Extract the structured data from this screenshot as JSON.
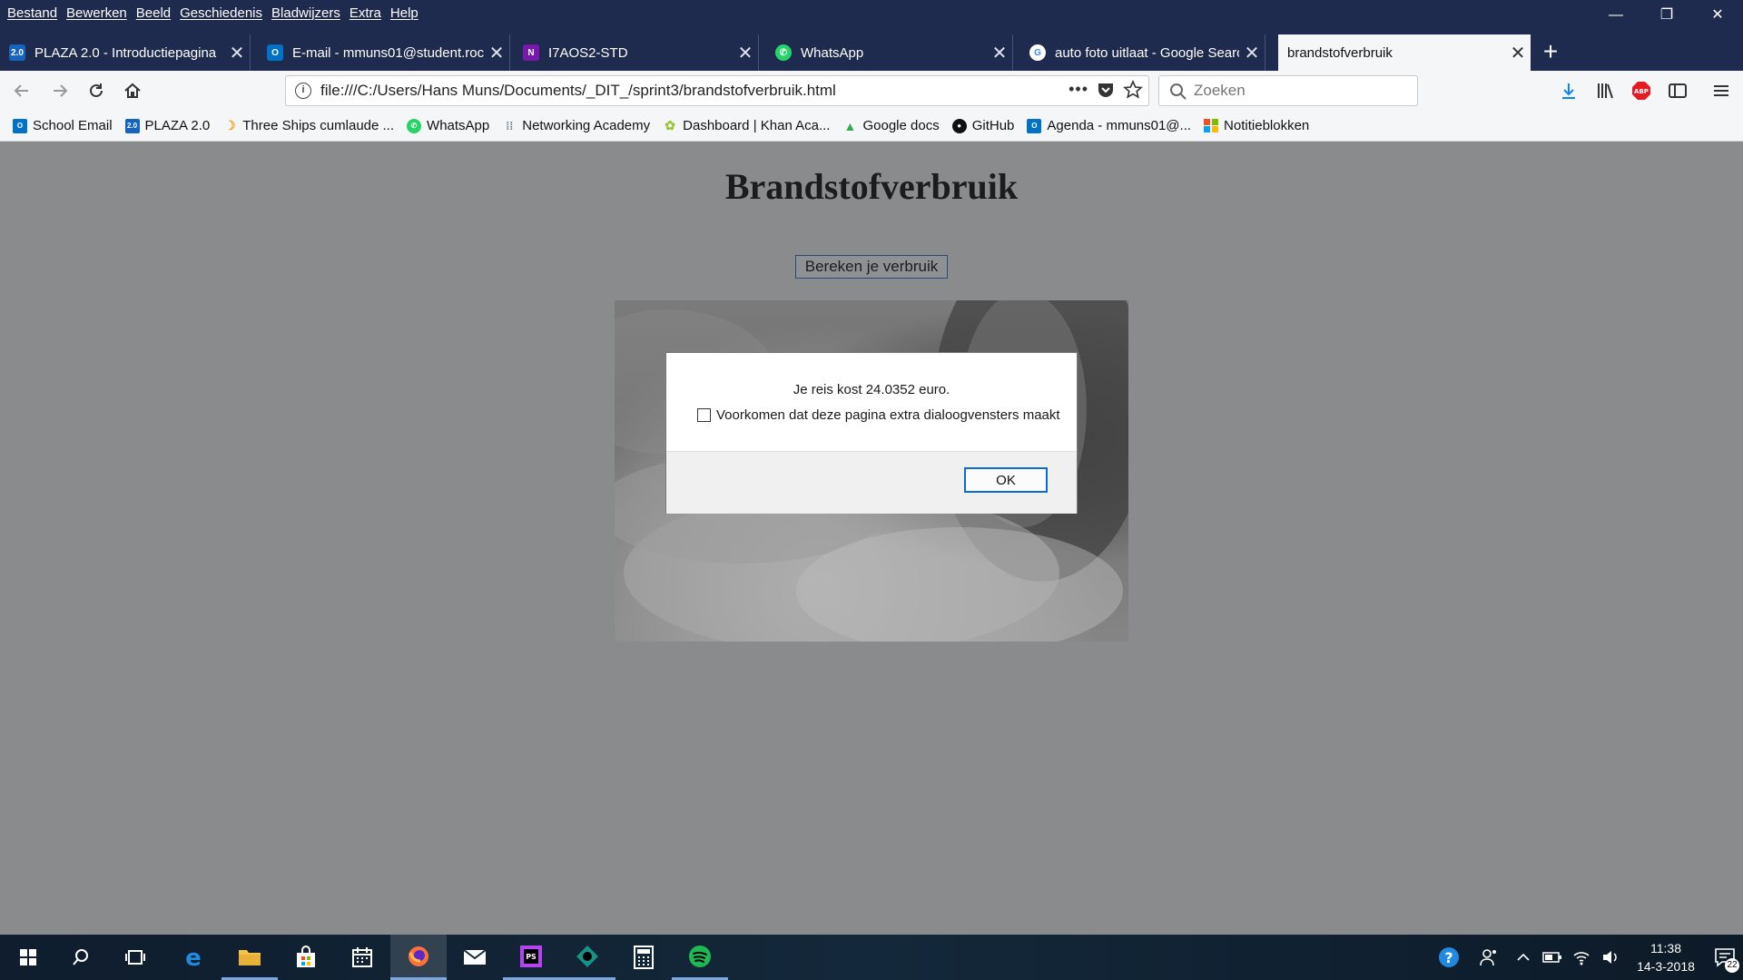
{
  "menubar": {
    "items": [
      "Bestand",
      "Bewerken",
      "Beeld",
      "Geschiedenis",
      "Bladwijzers",
      "Extra",
      "Help"
    ]
  },
  "window_controls": {
    "minimize": "—",
    "restore": "❐",
    "close": "✕"
  },
  "tabs": [
    {
      "label": "PLAZA 2.0 - Introductiepagina",
      "icon": "plaza-icon",
      "color": "#1565c0",
      "active": false
    },
    {
      "label": "E-mail - mmuns01@student.roc",
      "icon": "outlook-icon",
      "color": "#0072c6",
      "active": false
    },
    {
      "label": "I7AOS2-STD",
      "icon": "onenote-icon",
      "color": "#7719aa",
      "active": false
    },
    {
      "label": "WhatsApp",
      "icon": "whatsapp-icon",
      "color": "#25d366",
      "active": false
    },
    {
      "label": "auto foto uitlaat - Google Search",
      "icon": "google-icon",
      "color": "#ffffff",
      "active": false
    },
    {
      "label": "brandstofverbruik",
      "icon": "",
      "color": "",
      "active": true
    }
  ],
  "navbar": {
    "url": "file:///C:/Users/Hans Muns/Documents/_DIT_/sprint3/brandstofverbruik.html",
    "search_placeholder": "Zoeken"
  },
  "bookmarks": [
    {
      "label": "School Email",
      "icon": "outlook-icon",
      "color": "#0072c6"
    },
    {
      "label": "PLAZA 2.0",
      "icon": "plaza-icon",
      "color": "#1565c0"
    },
    {
      "label": "Three Ships cumlaude ...",
      "icon": "moon-icon",
      "color": "#f5a623"
    },
    {
      "label": "WhatsApp",
      "icon": "whatsapp-icon",
      "color": "#25d366"
    },
    {
      "label": "Networking Academy",
      "icon": "cisco-icon",
      "color": "#6b7b8c"
    },
    {
      "label": "Dashboard | Khan Aca...",
      "icon": "khan-icon",
      "color": "#9bc53d"
    },
    {
      "label": "Google docs",
      "icon": "drive-icon",
      "color": "#34a853"
    },
    {
      "label": "GitHub",
      "icon": "github-icon",
      "color": "#111111"
    },
    {
      "label": "Agenda - mmuns01@...",
      "icon": "outlook-icon",
      "color": "#0072c6"
    },
    {
      "label": "Notitieblokken",
      "icon": "microsoft-icon",
      "color": "#f25022"
    }
  ],
  "page": {
    "title": "Brandstofverbruik",
    "button_label": "Bereken je verbruik"
  },
  "dialog": {
    "message": "Je reis kost 24.0352 euro.",
    "checkbox_label": "Voorkomen dat deze pagina extra dialoogvensters maakt",
    "checkbox_checked": false,
    "ok_label": "OK"
  },
  "taskbar": {
    "time": "11:38",
    "date": "14-3-2018",
    "notification_count": "22"
  }
}
